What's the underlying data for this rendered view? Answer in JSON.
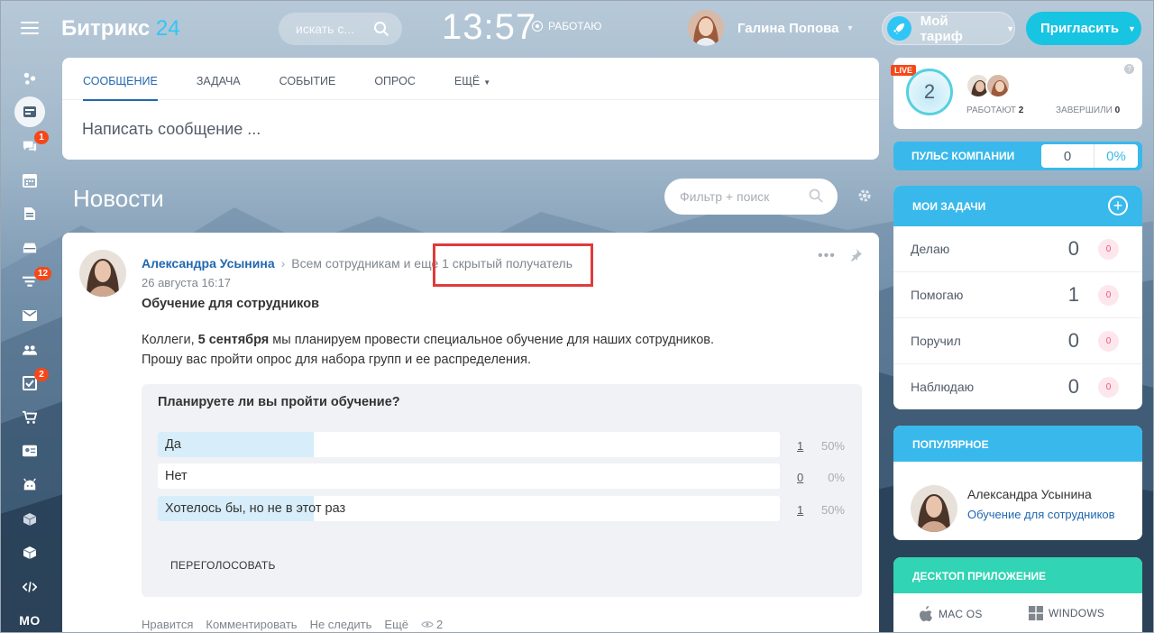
{
  "header": {
    "logo_name": "Битрикс",
    "logo_number": "24",
    "search_placeholder": "искать с...",
    "clock": "13:57",
    "work_status": "РАБОТАЮ",
    "user_name": "Галина Попова",
    "tariff_label": "Мой тариф",
    "invite_label": "Пригласить"
  },
  "sidebar": {
    "badges": {
      "chat": "1",
      "feed": "12",
      "tasks": "2"
    },
    "bottom_label": "МО"
  },
  "composer": {
    "tabs": [
      "СООБЩЕНИЕ",
      "ЗАДАЧА",
      "СОБЫТИЕ",
      "ОПРОС",
      "ЕЩЁ"
    ],
    "placeholder": "Написать сообщение ..."
  },
  "news": {
    "title": "Новости",
    "filter_placeholder": "Фильтр + поиск"
  },
  "post": {
    "author": "Александра Усынина",
    "recipients": "Всем сотрудникам и еще 1 скрытый получатель",
    "date": "26 августа 16:17",
    "title": "Обучение для сотрудников",
    "body_intro": "Коллеги, ",
    "body_bold": "5 сентября",
    "body_rest": " мы планируем провести специальное обучение для наших сотрудников.",
    "body_line2": "Прошу вас пройти опрос для набора групп и ее распределения.",
    "poll": {
      "question": "Планируете ли вы пройти обучение?",
      "options": [
        {
          "label": "Да",
          "count": "1",
          "percent": "50%",
          "fill": 0.5
        },
        {
          "label": "Нет",
          "count": "0",
          "percent": "0%",
          "fill": 0
        },
        {
          "label": "Хотелось бы, но не в этот раз",
          "count": "1",
          "percent": "50%",
          "fill": 0.5
        }
      ],
      "revote_label": "ПЕРЕГОЛОСОВАТЬ"
    },
    "actions": {
      "like": "Нравится",
      "comment": "Комментировать",
      "unfollow": "Не следить",
      "more": "Ещё",
      "views": "2"
    }
  },
  "right": {
    "live": {
      "live_tag": "LIVE",
      "count": "2",
      "working_label": "РАБОТАЮТ",
      "working_count": "2",
      "finished_label": "ЗАВЕРШИЛИ",
      "finished_count": "0",
      "help": "?"
    },
    "pulse": {
      "label": "ПУЛЬС КОМПАНИИ",
      "value": "0",
      "percent": "0%"
    },
    "tasks": {
      "title": "МОИ ЗАДАЧИ",
      "rows": [
        {
          "label": "Делаю",
          "count": "0",
          "badge": "0"
        },
        {
          "label": "Помогаю",
          "count": "1",
          "badge": "0"
        },
        {
          "label": "Поручил",
          "count": "0",
          "badge": "0"
        },
        {
          "label": "Наблюдаю",
          "count": "0",
          "badge": "0"
        }
      ]
    },
    "popular": {
      "title": "ПОПУЛЯРНОЕ",
      "author": "Александра Усынина",
      "link": "Обучение для сотрудников"
    },
    "desktop": {
      "title": "ДЕСКТОП ПРИЛОЖЕНИЕ",
      "mac": "MAC OS",
      "windows": "WINDOWS"
    }
  },
  "colors": {
    "accent": "#2fc6f6",
    "link": "#2067b0",
    "badge": "#f54819",
    "highlight": "#e03b3b"
  }
}
